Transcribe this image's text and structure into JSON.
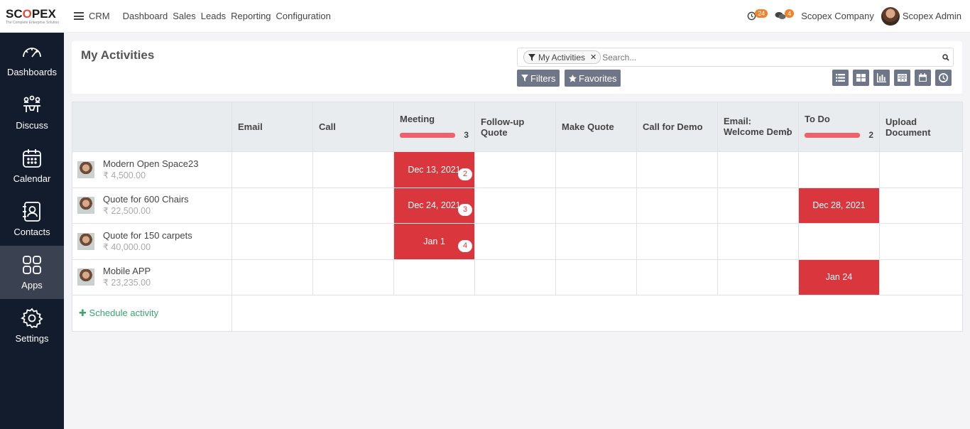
{
  "brand": {
    "logo_prefix": "SC",
    "logo_o": "O",
    "logo_suffix": "PEX",
    "tagline": "The Complete Enterprise Solution"
  },
  "topbar": {
    "app_name": "CRM",
    "menu": [
      "Dashboard",
      "Sales",
      "Leads",
      "Reporting",
      "Configuration"
    ],
    "activity_count": "24",
    "message_count": "4",
    "company": "Scopex Company",
    "user": "Scopex Admin",
    "badge_color": "#f0822a"
  },
  "sidebar": {
    "items": [
      {
        "label": "Dashboards",
        "icon": "speedometer-icon"
      },
      {
        "label": "Discuss",
        "icon": "discuss-icon"
      },
      {
        "label": "Calendar",
        "icon": "calendar-icon"
      },
      {
        "label": "Contacts",
        "icon": "contacts-icon"
      },
      {
        "label": "Apps",
        "icon": "apps-icon",
        "active": true
      },
      {
        "label": "Settings",
        "icon": "gear-icon"
      }
    ],
    "background": "#121c2c"
  },
  "control_panel": {
    "title": "My Activities",
    "facet_label": "My Activities",
    "search_placeholder": "Search...",
    "filters_label": "Filters",
    "favorites_label": "Favorites",
    "views": [
      "list-view-icon",
      "kanban-view-icon",
      "graph-view-icon",
      "pivot-view-icon",
      "calendar-view-icon",
      "activity-view-icon"
    ]
  },
  "grid": {
    "columns": [
      {
        "label": "Email"
      },
      {
        "label": "Call"
      },
      {
        "label": "Meeting",
        "progress_count": "3"
      },
      {
        "label": "Follow-up Quote"
      },
      {
        "label": "Make Quote"
      },
      {
        "label": "Call for Demo"
      },
      {
        "label": "Email: Welcome Demo"
      },
      {
        "label": "To Do",
        "progress_count": "2"
      },
      {
        "label": "Upload Document"
      }
    ],
    "rows": [
      {
        "name": "Modern Open Space23",
        "amount": "₹ 4,500.00"
      },
      {
        "name": "Quote for 600 Chairs",
        "amount": "₹ 22,500.00"
      },
      {
        "name": "Quote for 150 carpets",
        "amount": "₹ 40,000.00"
      },
      {
        "name": "Mobile APP",
        "amount": "₹ 23,235.00"
      }
    ],
    "activities": {
      "r0_meeting": {
        "date": "Dec 13, 2021",
        "count": "2"
      },
      "r1_meeting": {
        "date": "Dec 24, 2021",
        "count": "3"
      },
      "r1_todo": {
        "date": "Dec 28, 2021"
      },
      "r2_meeting": {
        "date": "Jan 1",
        "count": "4"
      },
      "r3_todo": {
        "date": "Jan 24"
      }
    },
    "schedule_label": "Schedule activity",
    "overdue_color": "#d9363e"
  }
}
